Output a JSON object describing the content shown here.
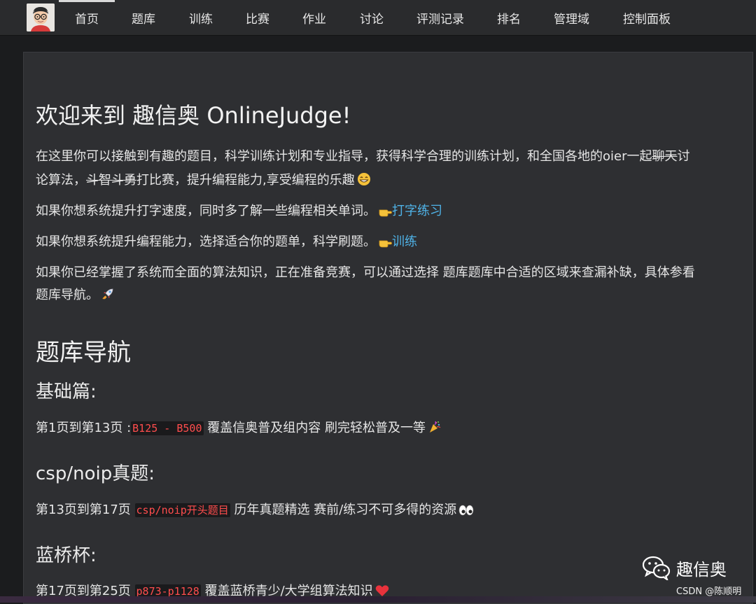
{
  "nav": {
    "items": [
      "首页",
      "题库",
      "训练",
      "比赛",
      "作业",
      "讨论",
      "评测记录",
      "排名",
      "管理域",
      "控制面板"
    ],
    "active": "首页"
  },
  "main": {
    "title": "欢迎来到 趣信奥 OnlineJudge!",
    "intro_a": "在这里你可以接触到有趣的题目，科学训练计划和专业指导，获得科学合理的训练计划，和全国各地的oier一起",
    "intro_strike1": "聊天",
    "intro_b": "讨",
    "intro_c": "论算法，",
    "intro_strike2": "斗智斗勇",
    "intro_d": "打比赛，提升编程能力,享受编程的乐趣",
    "typing_text": "如果你想系统提升打字速度，同时多了解一些编程相关单词。",
    "typing_link": "打字练习",
    "training_text": "如果你想系统提升编程能力，选择适合你的题单，科学刷题。",
    "training_link": "训练",
    "nav_text_1": "如果你已经掌握了系统而全面的算法知识，正在准备竞赛，可以通过选择 题库题库中合适的区域来查漏补缺，具体参看",
    "nav_text_2": "题库导航。",
    "nav_heading": "题库导航",
    "sections": [
      {
        "heading": "基础篇:",
        "prefix": "第1页到第13页 :",
        "code": "B125 - B500",
        "suffix": " 覆盖信奥普及组内容 刷完轻松普及一等",
        "emoji": "party-popper-icon"
      },
      {
        "heading": "csp/noip真题:",
        "prefix": "第13页到第17页 ",
        "code": "csp/noip开头题目",
        "suffix": " 历年真题精选 赛前/练习不可多得的资源",
        "emoji": "eyes-icon"
      },
      {
        "heading": "蓝桥杯:",
        "prefix": "第17页到第25页 ",
        "code": "p873-p1128",
        "suffix": " 覆盖蓝桥青少/大学组算法知识",
        "emoji": "heart-icon"
      }
    ]
  },
  "watermark": {
    "brand": "趣信奥",
    "csdn": "CSDN @陈顺明"
  },
  "colors": {
    "link": "#4fb3e8",
    "code": "#ff4d4d",
    "background": "#2e2f32"
  }
}
